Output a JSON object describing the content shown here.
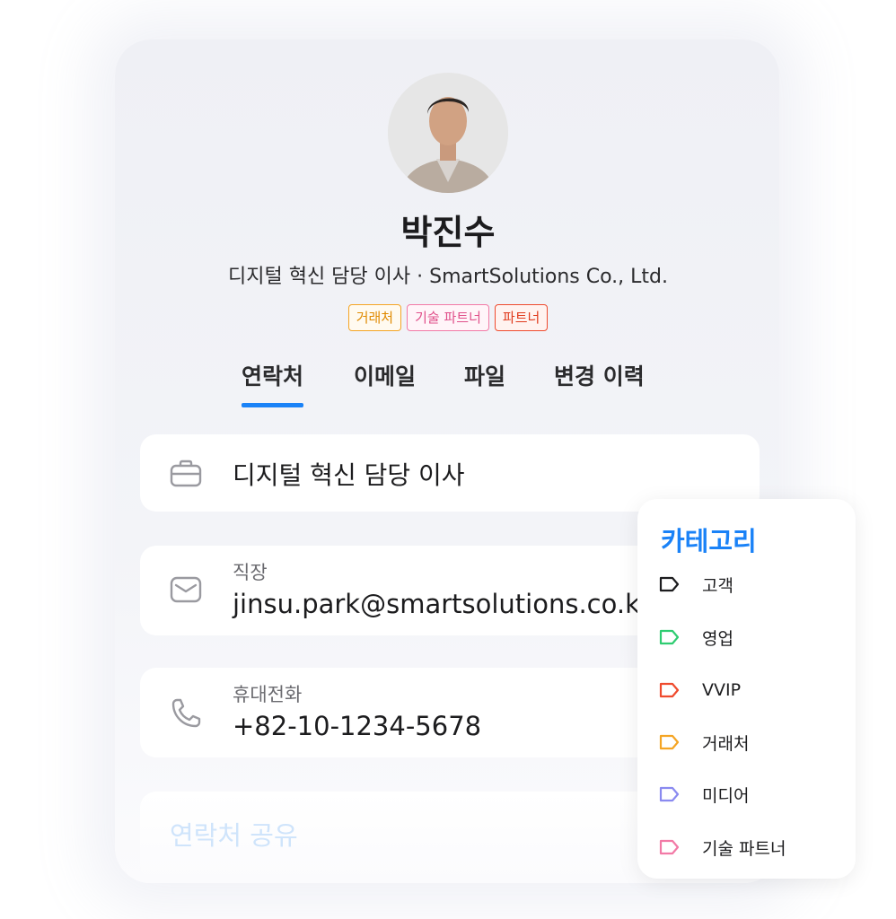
{
  "profile": {
    "name": "박진수",
    "subtitle": "디지털 혁신 담당 이사 · SmartSolutions Co., Ltd.",
    "tags": [
      "거래처",
      "기술 파트너",
      "파트너"
    ]
  },
  "tabs": [
    "연락처",
    "이메일",
    "파일",
    "변경 이력"
  ],
  "active_tab": "연락처",
  "contact": {
    "job_title": "디지털 혁신 담당 이사",
    "email_label": "직장",
    "email_value": "jinsu.park@smartsolutions.co.kr",
    "phone_label": "휴대전화",
    "phone_value": "+82-10-1234-5678",
    "share_label": "연락처 공유"
  },
  "categories": {
    "title": "카테고리",
    "items": [
      {
        "label": "고객",
        "color": "#1c1c1e"
      },
      {
        "label": "영업",
        "color": "#2ecc71"
      },
      {
        "label": "VVIP",
        "color": "#ef4b2e"
      },
      {
        "label": "거래처",
        "color": "#f5a524"
      },
      {
        "label": "미디어",
        "color": "#8a8af0"
      },
      {
        "label": "기술 파트너",
        "color": "#f27aa6"
      }
    ]
  },
  "colors": {
    "accent": "#1a82f7"
  }
}
